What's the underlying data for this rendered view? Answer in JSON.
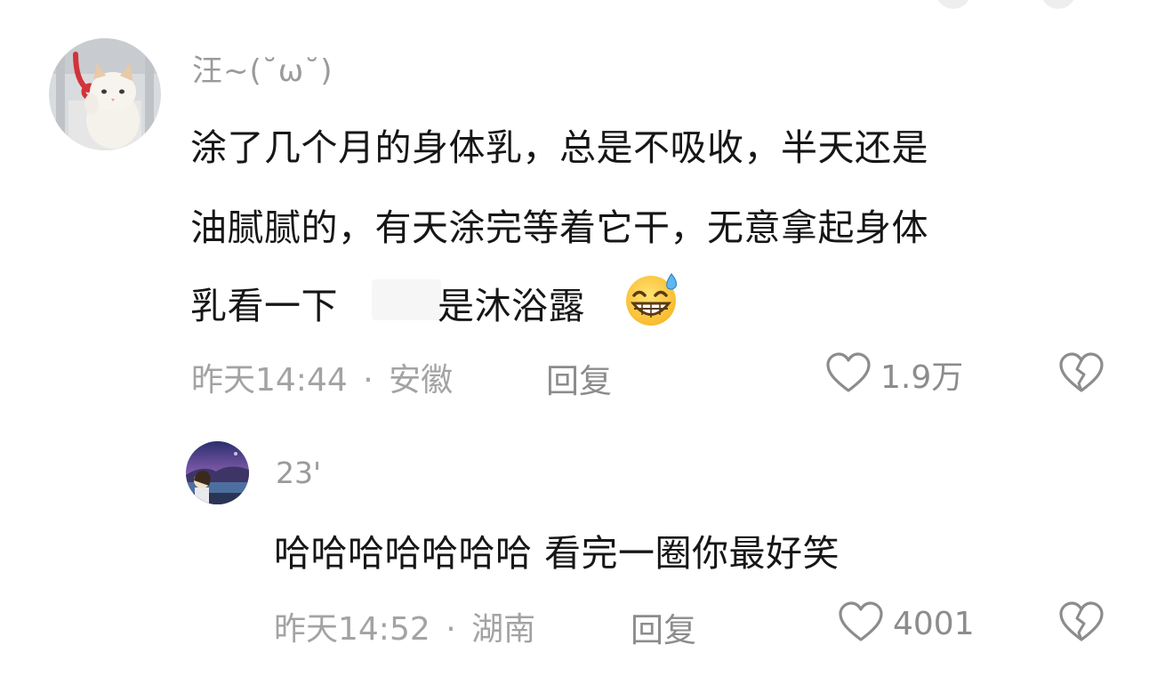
{
  "comments": [
    {
      "username": "汪~(˘ω˘)",
      "lines": [
        "涂了几个月的身体乳，总是不吸收，半天还是",
        "油腻腻的，有天涂完等着它干，无意拿起身体",
        "乳看一下",
        "是沐浴露"
      ],
      "emoji": "grinning-sweat-emoji",
      "time": "昨天14:44",
      "separator": "·",
      "location": "安徽",
      "reply_label": "回复",
      "like_count": "1.9万"
    }
  ],
  "replies": [
    {
      "username": "23'",
      "text": "哈哈哈哈哈哈哈 看完一圈你最好笑",
      "time": "昨天14:52",
      "separator": "·",
      "location": "湖南",
      "reply_label": "回复",
      "like_count": "4001"
    }
  ],
  "icons": {
    "like": "heart-outline-icon",
    "dislike": "broken-heart-icon"
  },
  "colors": {
    "meta": "#a3a3a3",
    "text": "#161616",
    "username": "#9a9a9a"
  }
}
